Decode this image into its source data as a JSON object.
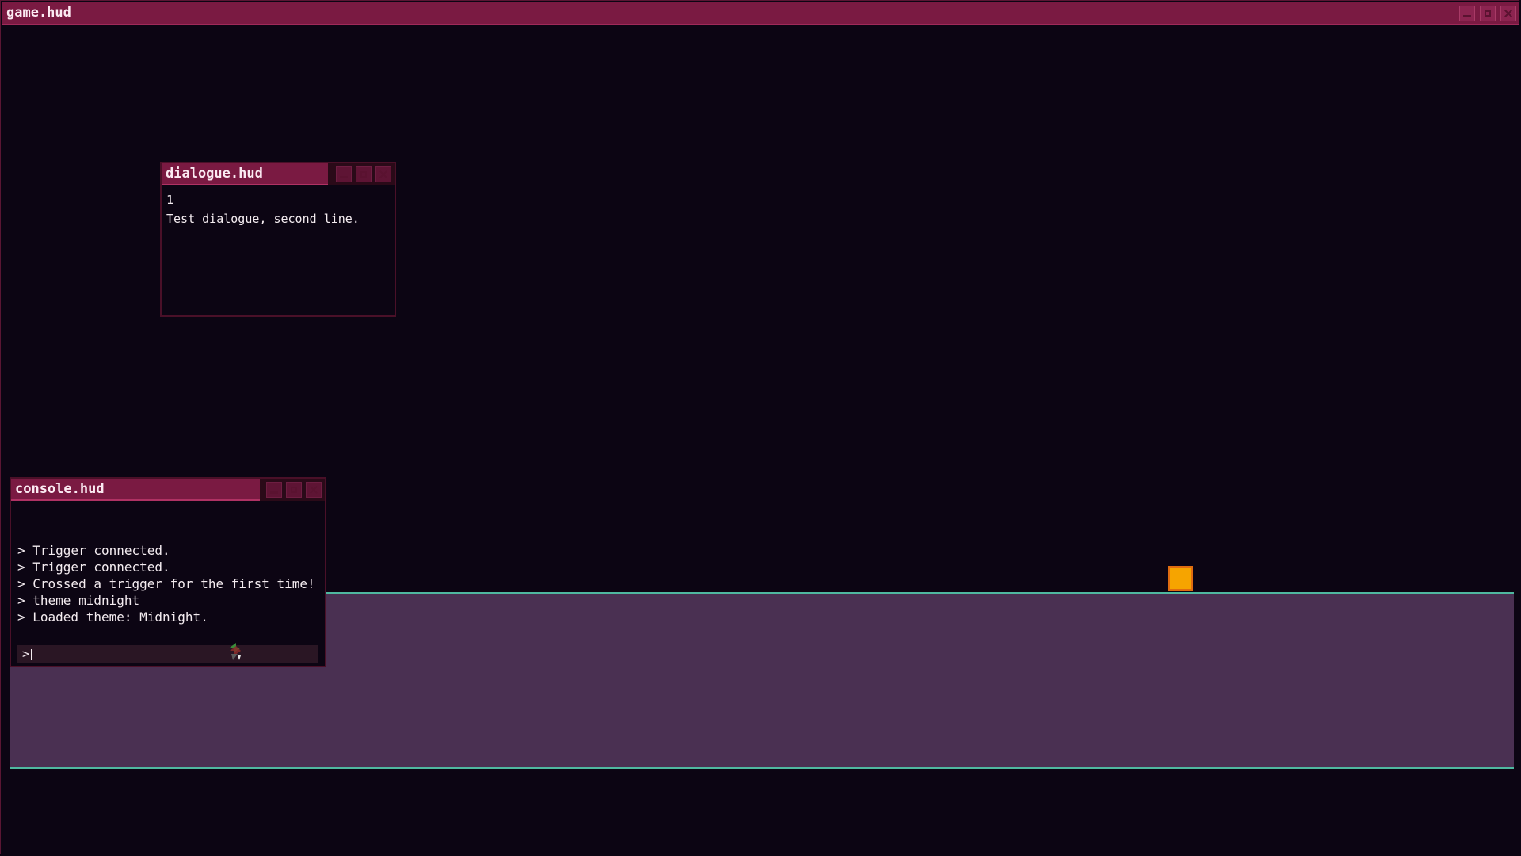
{
  "window": {
    "title": "game.hud"
  },
  "colors": {
    "accent": "#7a1a42",
    "background": "#0c0513",
    "ground": "#4a3052",
    "ground_edge": "#4fb8a0",
    "player": "#f6a400"
  },
  "dialogue": {
    "title": "dialogue.hud",
    "speaker": "1",
    "text": "Test dialogue, second line."
  },
  "console": {
    "title": "console.hud",
    "lines": [
      "> Trigger connected.",
      "> Trigger connected.",
      "> Crossed a trigger for the first time!",
      "> theme midnight",
      "> Loaded theme: Midnight."
    ],
    "prompt": ">"
  },
  "icons": {
    "minimize": "minimize-icon",
    "maximize": "maximize-icon",
    "close": "close-icon",
    "cursor": "game-cursor-icon"
  }
}
